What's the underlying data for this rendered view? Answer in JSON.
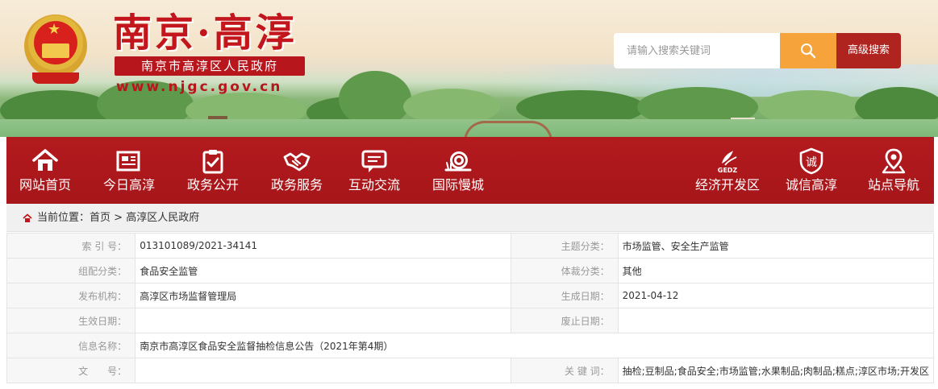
{
  "header": {
    "site_title": "南京·高淳",
    "site_subtitle": "南京市高淳区人民政府",
    "site_url": "www.njgc.gov.cn",
    "search_placeholder": "请输入搜索关键词",
    "advanced_search_label": "高级搜索",
    "search_icon": "search-icon"
  },
  "nav": {
    "items": [
      {
        "label": "网站首页",
        "icon": "home-icon"
      },
      {
        "label": "今日高淳",
        "icon": "newspaper-icon"
      },
      {
        "label": "政务公开",
        "icon": "clipboard-check-icon"
      },
      {
        "label": "政务服务",
        "icon": "handshake-icon"
      },
      {
        "label": "互动交流",
        "icon": "chat-icon"
      },
      {
        "label": "国际慢城",
        "icon": "snail-icon"
      },
      {
        "label": "经济开发区",
        "icon": "gedz-logo-icon",
        "icon_text": "GEDZ"
      },
      {
        "label": "诚信高淳",
        "icon": "integrity-badge-icon",
        "icon_text": "诚"
      },
      {
        "label": "站点导航",
        "icon": "map-pin-icon"
      }
    ]
  },
  "breadcrumb": {
    "prefix": "当前位置：",
    "home": "首页",
    "separator": ">",
    "current": "高淳区人民政府"
  },
  "info": {
    "index_label": "索 引 号：",
    "index_value": "013101089/2021-34141",
    "topic_label": "主题分类：",
    "topic_value": "市场监管、安全生产监管",
    "category_label": "组配分类：",
    "category_value": "食品安全监管",
    "genre_label": "体裁分类：",
    "genre_value": "其他",
    "publisher_label": "发布机构：",
    "publisher_value": "高淳区市场监督管理局",
    "created_label": "生成日期：",
    "created_value": "2021-04-12",
    "effective_label": "生效日期：",
    "effective_value": "",
    "abolished_label": "废止日期：",
    "abolished_value": "",
    "name_label": "信息名称：",
    "name_value": "南京市高淳区食品安全监督抽检信息公告（2021年第4期）",
    "docno_label": "文　　号：",
    "docno_value": "",
    "keywords_label": "关 键 词：",
    "keywords_value": "抽检;豆制品;食品安全;市场监管;水果制品;肉制品;糕点;淳区市场;开发区"
  },
  "colors": {
    "brand_red": "#a6161a",
    "search_orange": "#f5a33a"
  }
}
